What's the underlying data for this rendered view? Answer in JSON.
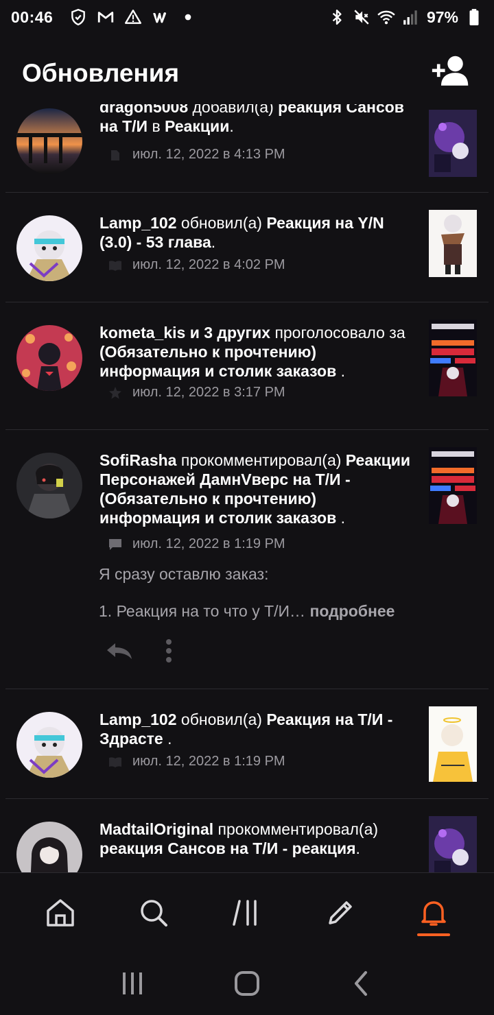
{
  "status_bar": {
    "time": "00:46",
    "battery": "97%",
    "icons_left": [
      "shield-icon",
      "gmail-icon",
      "warning-icon",
      "wattpad-icon",
      "dot-icon"
    ],
    "icons_right": [
      "bluetooth-icon",
      "mute-icon",
      "wifi-icon",
      "signal-icon",
      "battery-icon"
    ]
  },
  "header": {
    "title": "Обновления",
    "action_icon": "add-friend-icon"
  },
  "accent_color": "#ff6122",
  "feed": [
    {
      "user": "dragon5008",
      "action": "добавил(а)",
      "story": "реакция Сансов на Т/И",
      "extra_prefix": "в",
      "extra": "Реакции",
      "suffix": ".",
      "time": "июл. 12, 2022 в 4:13 PM",
      "meta_icon": "reading-list-icon"
    },
    {
      "user": "Lamp_102",
      "action": "обновил(а)",
      "story": "Реакция на Y/N (3.0) - 53 глава",
      "suffix": ".",
      "time": "июл. 12, 2022 в 4:02 PM",
      "meta_icon": "book-icon"
    },
    {
      "user": "kometa_kis и 3 других",
      "action": "проголосовало за",
      "story": "(Обязательно к прочтению) информация и столик заказов",
      "suffix": ".",
      "time": "июл. 12, 2022 в 3:17 PM",
      "meta_icon": "star-icon"
    },
    {
      "user": "SofiRasha",
      "action": "прокомментировал(а)",
      "story": "Реакции Персонажей ДамнVверс на Т/И - (Обязательно к прочтению) информация и столик заказов",
      "suffix": ".",
      "time": "июл. 12, 2022 в 1:19 PM",
      "meta_icon": "comment-icon",
      "comment_line1": "Я сразу оставлю заказ:",
      "comment_line2": "1. Реакция на то что у Т/И…",
      "more": "подробнее"
    },
    {
      "user": "Lamp_102",
      "action": "обновил(а)",
      "story": "Реакция на Т/И - Здрасте",
      "suffix": ".",
      "time": "июл. 12, 2022 в 1:19 PM",
      "meta_icon": "book-icon"
    },
    {
      "user": "MadtailOriginal",
      "action": "прокомментировал(а)",
      "story": "реакция Сансов на Т/И - реакция",
      "suffix": "."
    }
  ],
  "bottom_nav": [
    "home-icon",
    "search-icon",
    "library-icon",
    "write-icon",
    "notifications-icon"
  ],
  "system_nav": [
    "recents-icon",
    "home-button-icon",
    "back-icon"
  ]
}
